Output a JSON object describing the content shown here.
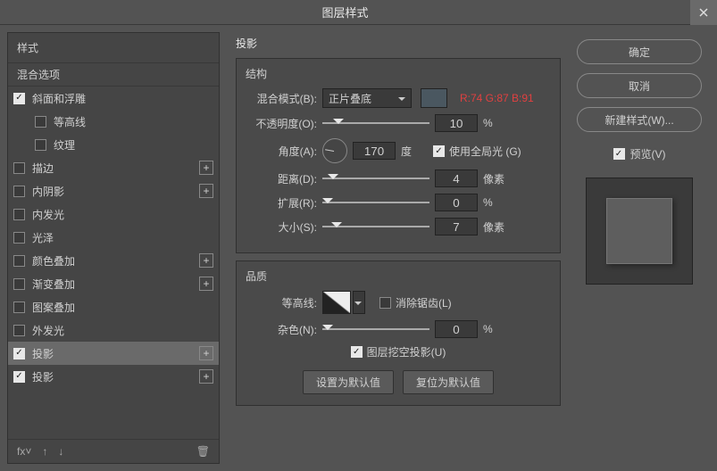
{
  "title": "图层样式",
  "colorInfo": "R:74 G:87 B:91",
  "left": {
    "header": "样式",
    "blend": "混合选项",
    "items": [
      {
        "label": "斜面和浮雕",
        "checked": true,
        "plus": false,
        "sub": false
      },
      {
        "label": "等高线",
        "checked": false,
        "plus": false,
        "sub": true
      },
      {
        "label": "纹理",
        "checked": false,
        "plus": false,
        "sub": true
      },
      {
        "label": "描边",
        "checked": false,
        "plus": true,
        "sub": false
      },
      {
        "label": "内阴影",
        "checked": false,
        "plus": true,
        "sub": false
      },
      {
        "label": "内发光",
        "checked": false,
        "plus": false,
        "sub": false
      },
      {
        "label": "光泽",
        "checked": false,
        "plus": false,
        "sub": false
      },
      {
        "label": "颜色叠加",
        "checked": false,
        "plus": true,
        "sub": false
      },
      {
        "label": "渐变叠加",
        "checked": false,
        "plus": true,
        "sub": false
      },
      {
        "label": "图案叠加",
        "checked": false,
        "plus": false,
        "sub": false
      },
      {
        "label": "外发光",
        "checked": false,
        "plus": false,
        "sub": false
      },
      {
        "label": "投影",
        "checked": true,
        "plus": true,
        "sub": false,
        "selected": true
      },
      {
        "label": "投影",
        "checked": true,
        "plus": true,
        "sub": false
      }
    ]
  },
  "mid": {
    "title": "投影",
    "structure": {
      "label": "结构",
      "blendMode": {
        "label": "混合模式(B):",
        "value": "正片叠底"
      },
      "opacity": {
        "label": "不透明度(O):",
        "value": "10",
        "unit": "%",
        "pos": 10
      },
      "angle": {
        "label": "角度(A):",
        "value": "170",
        "unit": "度",
        "global": "使用全局光 (G)"
      },
      "distance": {
        "label": "距离(D):",
        "value": "4",
        "unit": "像素",
        "pos": 5
      },
      "spread": {
        "label": "扩展(R):",
        "value": "0",
        "unit": "%",
        "pos": 0
      },
      "size": {
        "label": "大小(S):",
        "value": "7",
        "unit": "像素",
        "pos": 8
      }
    },
    "quality": {
      "label": "品质",
      "contour": {
        "label": "等高线:",
        "antialias": "消除锯齿(L)"
      },
      "noise": {
        "label": "杂色(N):",
        "value": "0",
        "unit": "%",
        "pos": 0
      },
      "knockout": "图层挖空投影(U)"
    },
    "buttons": {
      "default": "设置为默认值",
      "reset": "复位为默认值"
    }
  },
  "right": {
    "ok": "确定",
    "cancel": "取消",
    "newStyle": "新建样式(W)...",
    "preview": "预览(V)"
  }
}
